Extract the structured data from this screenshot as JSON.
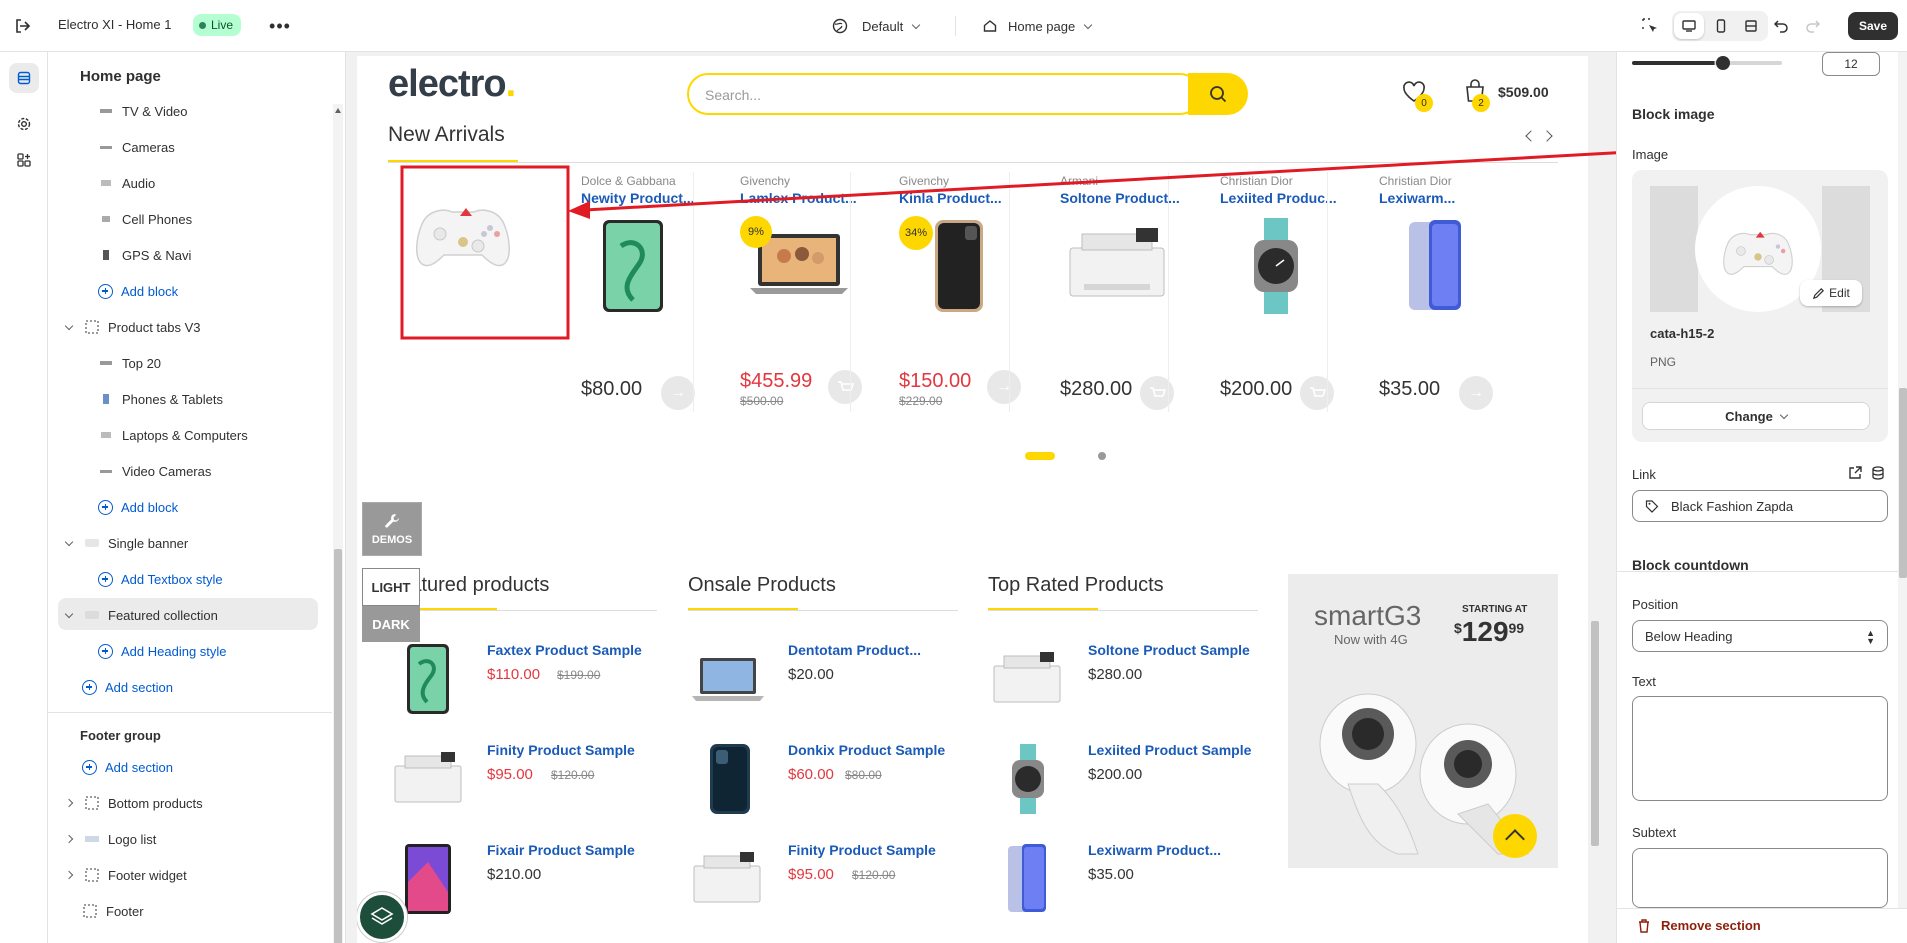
{
  "topbar": {
    "store_name": "Electro XI - Home 1",
    "live_badge": "Live",
    "theme_selector": "Default",
    "page_selector": "Home page",
    "save_label": "Save"
  },
  "sidebar": {
    "title": "Home page",
    "items": [
      {
        "label": "TV & Video"
      },
      {
        "label": "Cameras"
      },
      {
        "label": "Audio"
      },
      {
        "label": "Cell Phones"
      },
      {
        "label": "GPS & Navi"
      },
      {
        "label": "Add block"
      },
      {
        "label": "Product tabs V3"
      },
      {
        "label": "Top 20"
      },
      {
        "label": "Phones & Tablets"
      },
      {
        "label": "Laptops & Computers"
      },
      {
        "label": "Video Cameras"
      },
      {
        "label": "Add block"
      },
      {
        "label": "Single banner"
      },
      {
        "label": "Add Textbox style"
      },
      {
        "label": "Featured collection"
      },
      {
        "label": "Add Heading style"
      },
      {
        "label": "Add section"
      }
    ],
    "footer_group_title": "Footer group",
    "footer_items": [
      {
        "label": "Add section"
      },
      {
        "label": "Bottom products"
      },
      {
        "label": "Logo list"
      },
      {
        "label": "Footer widget"
      },
      {
        "label": "Footer"
      }
    ]
  },
  "store": {
    "logo": "electro",
    "search_placeholder": "Search...",
    "wishlist_count": "0",
    "cart_count": "2",
    "cart_total": "$509.00",
    "new_arrivals_title": "New Arrivals",
    "arrivals": [
      {
        "brand": "Dolce & Gabbana",
        "name": "Newity Product...",
        "price": "$80.00",
        "old": "",
        "badge": "",
        "sale": false
      },
      {
        "brand": "Givenchy",
        "name": "Lamlex Product...",
        "price": "$455.99",
        "old": "$500.00",
        "badge": "9%",
        "sale": true
      },
      {
        "brand": "Givenchy",
        "name": "Kinla Product...",
        "price": "$150.00",
        "old": "$229.00",
        "badge": "34%",
        "sale": true
      },
      {
        "brand": "Armani",
        "name": "Soltone Product...",
        "price": "$280.00",
        "old": "",
        "badge": "",
        "sale": false
      },
      {
        "brand": "Christian Dior",
        "name": "Lexiited Produc...",
        "price": "$200.00",
        "old": "",
        "badge": "",
        "sale": false
      },
      {
        "brand": "Christian Dior",
        "name": "Lexiwarm...",
        "price": "$35.00",
        "old": "",
        "badge": "",
        "sale": false
      }
    ],
    "demos_label": "DEMOS",
    "light_label": "LIGHT",
    "dark_label": "DARK",
    "featured_title": "Featured products",
    "onsale_title": "Onsale Products",
    "toprated_title": "Top Rated Products",
    "featured": [
      {
        "name": "Faxtex Product Sample",
        "price": "$110.00",
        "old": "$199.00",
        "sale": true
      },
      {
        "name": "Finity Product Sample",
        "price": "$95.00",
        "old": "$120.00",
        "sale": true
      },
      {
        "name": "Fixair Product Sample",
        "price": "$210.00",
        "old": "",
        "sale": false
      }
    ],
    "onsale": [
      {
        "name": "Dentotam Product...",
        "price": "$20.00",
        "old": "",
        "sale": false
      },
      {
        "name": "Donkix Product Sample",
        "price": "$60.00",
        "old": "$80.00",
        "sale": true
      },
      {
        "name": "Finity Product Sample",
        "price": "$95.00",
        "old": "$120.00",
        "sale": true
      }
    ],
    "toprated": [
      {
        "name": "Soltone Product Sample",
        "price": "$280.00",
        "old": "",
        "sale": false
      },
      {
        "name": "Lexiited Product Sample",
        "price": "$200.00",
        "old": "",
        "sale": false
      },
      {
        "name": "Lexiwarm Product...",
        "price": "$35.00",
        "old": "",
        "sale": false
      }
    ],
    "banner": {
      "brand": "smartG3",
      "sub": "Now with 4G",
      "starting": "STARTING AT",
      "dollar": "$",
      "amount": "129",
      "cents": "99"
    }
  },
  "settings": {
    "slider_value": "12",
    "block_image_title": "Block image",
    "image_label": "Image",
    "edit_label": "Edit",
    "file_name": "cata-h15-2",
    "file_type": "PNG",
    "change_label": "Change",
    "link_label": "Link",
    "link_value": "Black Fashion Zapda",
    "countdown_title": "Block countdown",
    "position_label": "Position",
    "position_value": "Below Heading",
    "text_label": "Text",
    "subtext_label": "Subtext",
    "remove_label": "Remove section"
  },
  "colors": {
    "accent_yellow": "#fed700",
    "link_blue": "#005bd3",
    "annotation_red": "#e01b24",
    "sale_red": "#e2373f"
  }
}
